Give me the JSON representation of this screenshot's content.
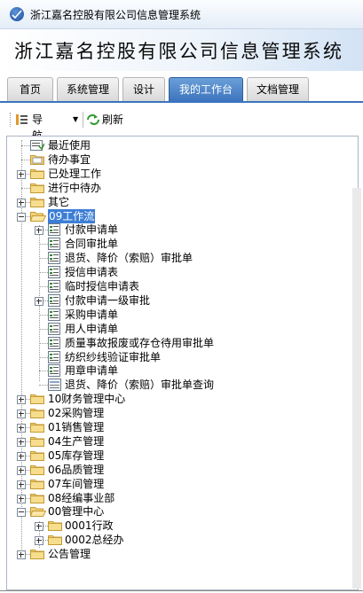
{
  "window": {
    "title": "浙江嘉名控股有限公司信息管理系统"
  },
  "banner": {
    "title": "浙江嘉名控股有限公司信息管理系统"
  },
  "tabs": [
    {
      "label": "首页",
      "active": false
    },
    {
      "label": "系统管理",
      "active": false
    },
    {
      "label": "设计",
      "active": false
    },
    {
      "label": "我的工作台",
      "active": true
    },
    {
      "label": "文档管理",
      "active": false
    }
  ],
  "toolbar": {
    "nav_label": "导航图",
    "refresh_label": "刷新"
  },
  "tree": [
    {
      "label": "最近使用",
      "level": 0,
      "icon": "recent-icon",
      "expander": "none"
    },
    {
      "label": "待办事宜",
      "level": 0,
      "icon": "todo-icon",
      "expander": "none"
    },
    {
      "label": "已处理工作",
      "level": 0,
      "icon": "folder-icon",
      "expander": "plus"
    },
    {
      "label": "进行中待办",
      "level": 0,
      "icon": "folder-icon",
      "expander": "none"
    },
    {
      "label": "其它",
      "level": 0,
      "icon": "folder-icon",
      "expander": "plus"
    },
    {
      "label": "09工作流",
      "level": 0,
      "icon": "folder-open-icon",
      "expander": "minus",
      "selected": true
    },
    {
      "label": "付款申请单",
      "level": 1,
      "icon": "form-icon",
      "expander": "plus"
    },
    {
      "label": "合同审批单",
      "level": 1,
      "icon": "form-icon",
      "expander": "none"
    },
    {
      "label": "退货、降价（索赔）审批单",
      "level": 1,
      "icon": "form-icon",
      "expander": "none"
    },
    {
      "label": "授信申请表",
      "level": 1,
      "icon": "form-icon",
      "expander": "none"
    },
    {
      "label": "临时授信申请表",
      "level": 1,
      "icon": "form-icon",
      "expander": "none"
    },
    {
      "label": "付款申请一级审批",
      "level": 1,
      "icon": "form-icon",
      "expander": "plus"
    },
    {
      "label": "采购申请单",
      "level": 1,
      "icon": "form-icon",
      "expander": "none"
    },
    {
      "label": "用人申请单",
      "level": 1,
      "icon": "form-icon",
      "expander": "none"
    },
    {
      "label": "质量事故报废或存仓待用审批单",
      "level": 1,
      "icon": "form-icon",
      "expander": "none"
    },
    {
      "label": "纺织纱线验证审批单",
      "level": 1,
      "icon": "form-icon",
      "expander": "none"
    },
    {
      "label": "用章申请单",
      "level": 1,
      "icon": "form-icon",
      "expander": "none"
    },
    {
      "label": "退货、降价（索赔）审批单查询",
      "level": 1,
      "icon": "query-icon",
      "expander": "none"
    },
    {
      "label": "10财务管理中心",
      "level": 0,
      "icon": "folder-icon",
      "expander": "plus"
    },
    {
      "label": "02采购管理",
      "level": 0,
      "icon": "folder-icon",
      "expander": "plus"
    },
    {
      "label": "01销售管理",
      "level": 0,
      "icon": "folder-icon",
      "expander": "plus"
    },
    {
      "label": "04生产管理",
      "level": 0,
      "icon": "folder-icon",
      "expander": "plus"
    },
    {
      "label": "05库存管理",
      "level": 0,
      "icon": "folder-icon",
      "expander": "plus"
    },
    {
      "label": "06品质管理",
      "level": 0,
      "icon": "folder-icon",
      "expander": "plus"
    },
    {
      "label": "07车间管理",
      "level": 0,
      "icon": "folder-icon",
      "expander": "plus"
    },
    {
      "label": "08经编事业部",
      "level": 0,
      "icon": "folder-icon",
      "expander": "plus"
    },
    {
      "label": "00管理中心",
      "level": 0,
      "icon": "folder-open-icon",
      "expander": "minus"
    },
    {
      "label": "0001行政",
      "level": 1,
      "icon": "folder-icon",
      "expander": "plus"
    },
    {
      "label": "0002总经办",
      "level": 1,
      "icon": "folder-icon",
      "expander": "plus"
    },
    {
      "label": "公告管理",
      "level": 0,
      "icon": "folder-icon",
      "expander": "plus"
    }
  ]
}
